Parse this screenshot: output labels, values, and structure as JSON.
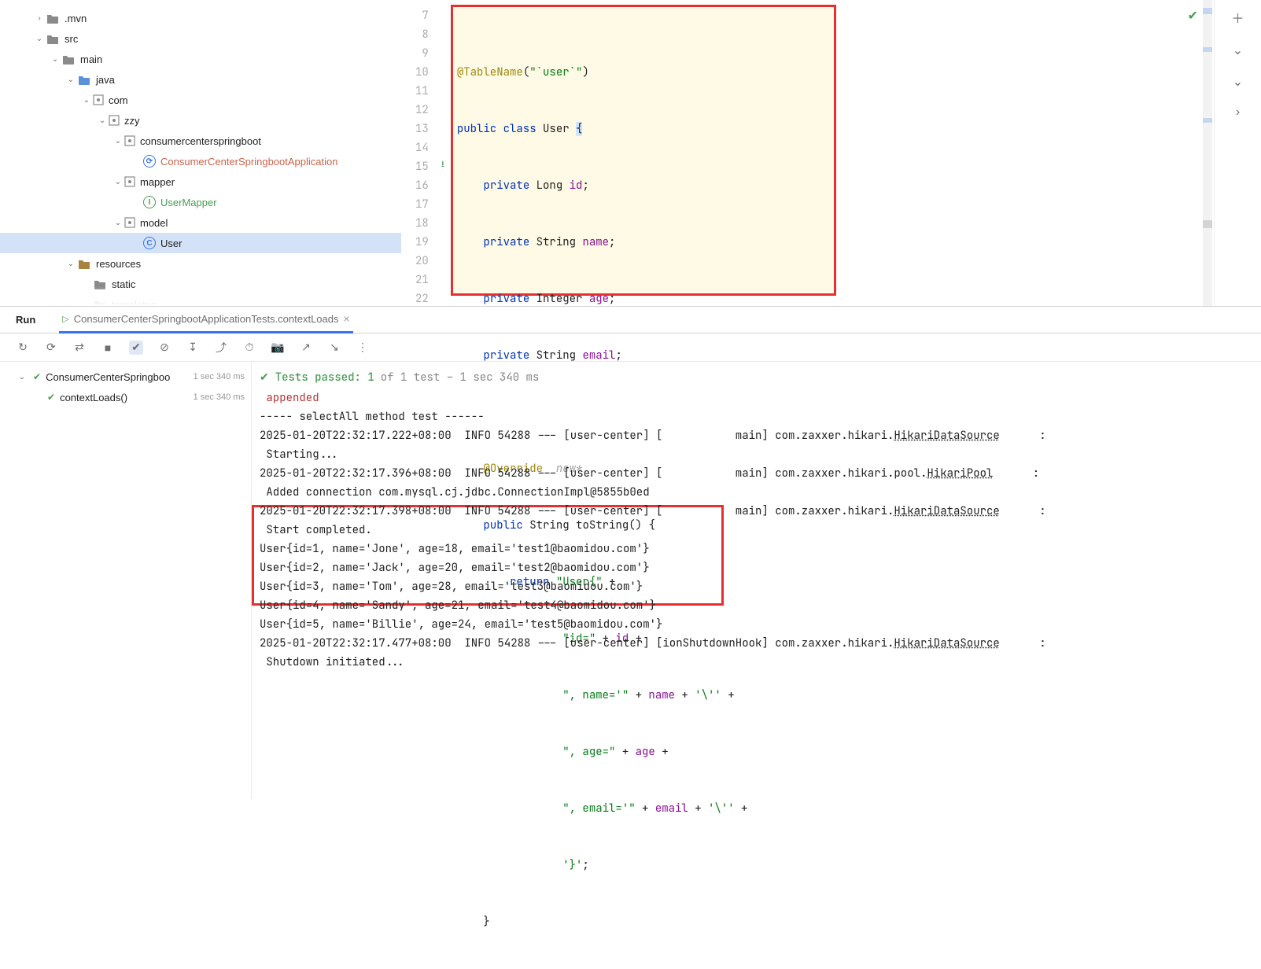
{
  "tree": {
    "mvn": ".mvn",
    "src": "src",
    "main": "main",
    "java": "java",
    "com": "com",
    "zzy": "zzy",
    "consumer": "consumercenterspringboot",
    "app_class": "ConsumerCenterSpringbootApplication",
    "mapper": "mapper",
    "user_mapper": "UserMapper",
    "model": "model",
    "user": "User",
    "resources": "resources",
    "static": "static",
    "templates": "templates"
  },
  "editor": {
    "lines": [
      "7",
      "8",
      "9",
      "10",
      "11",
      "12",
      "13",
      "14",
      "15",
      "16",
      "17",
      "18",
      "19",
      "20",
      "21",
      "22"
    ],
    "l7_ann": "@TableName",
    "l7_paren_open": "(",
    "l7_str": "\"`user`\"",
    "l7_paren_close": ")",
    "l8_kw1": "public class ",
    "l8_name": "User ",
    "l8_brace": "{",
    "l9_kw": "private ",
    "l9_t": "Long ",
    "l9_f": "id",
    "l9_s": ";",
    "l10_kw": "private ",
    "l10_t": "String ",
    "l10_f": "name",
    "l10_s": ";",
    "l11_kw": "private ",
    "l11_t": "Integer ",
    "l11_f": "age",
    "l11_s": ";",
    "l12_kw": "private ",
    "l12_t": "String ",
    "l12_f": "email",
    "l12_s": ";",
    "l14_ann": "@Override",
    "l14_hint": "  new*",
    "l15_kw": "public ",
    "l15_t": "String ",
    "l15_m": "toString() {",
    "l16_kw": "return ",
    "l16_s": "\"User{\"",
    "l16_p": " +",
    "l17_s": "\"id=\"",
    "l17_p": " + ",
    "l17_f": "id",
    "l17_p2": " +",
    "l18_s": "\", name='\"",
    "l18_p": " + ",
    "l18_f": "name",
    "l18_p2": " + ",
    "l18_s2": "'\\''",
    "l18_p3": " +",
    "l19_s": "\", age=\"",
    "l19_p": " + ",
    "l19_f": "age",
    "l19_p2": " +",
    "l20_s": "\", email='\"",
    "l20_p": " + ",
    "l20_f": "email",
    "l20_p2": " + ",
    "l20_s2": "'\\''",
    "l20_p3": " +",
    "l21_s": "'}'",
    "l21_p": ";",
    "l22": "    }"
  },
  "run": {
    "tab": "Run",
    "sub_tab": "ConsumerCenterSpringbootApplicationTests.contextLoads",
    "test_root": "ConsumerCenterSpringboo",
    "test_root_time": "1 sec 340 ms",
    "test_child": "contextLoads()",
    "test_child_time": "1 sec 340 ms",
    "passed_pre": "Tests passed: 1",
    "passed_post": " of 1 test – 1 sec 340 ms"
  },
  "console": {
    "appended": "appended",
    "sep": "----- selectAll method test ------",
    "line1_a": "2025-01-20T22:32:17.222+08:00  INFO 54288 --- [user-center] [           main] com.zaxxer.hikari.",
    "line1_b": "HikariDataSource",
    "line1_c": "      :",
    "line1d": " Starting...",
    "line2_a": "2025-01-20T22:32:17.396+08:00  INFO 54288 --- [user-center] [           main] com.zaxxer.hikari.pool.",
    "line2_b": "HikariPool",
    "line2_c": "      :",
    "line2d": " Added connection com.mysql.cj.jdbc.ConnectionImpl@5855b0ed",
    "line3_a": "2025-01-20T22:32:17.398+08:00  INFO 54288 --- [user-center] [           main] com.zaxxer.hikari.",
    "line3_b": "HikariDataSource",
    "line3_c": "      :",
    "line3d": " Start completed.",
    "u1": "User{id=1, name='Jone', age=18, email='test1@baomidou.com'}",
    "u2": "User{id=2, name='Jack', age=20, email='test2@baomidou.com'}",
    "u3": "User{id=3, name='Tom', age=28, email='test3@baomidou.com'}",
    "u4": "User{id=4, name='Sandy', age=21, email='test4@baomidou.com'}",
    "u5": "User{id=5, name='Billie', age=24, email='test5@baomidou.com'}",
    "line4_a": "2025-01-20T22:32:17.477+08:00  INFO 54288 --- [user-center] [ionShutdownHook] com.zaxxer.hikari.",
    "line4_b": "HikariDataSource",
    "line4_c": "      :",
    "line4d": " Shutdown initiated..."
  }
}
